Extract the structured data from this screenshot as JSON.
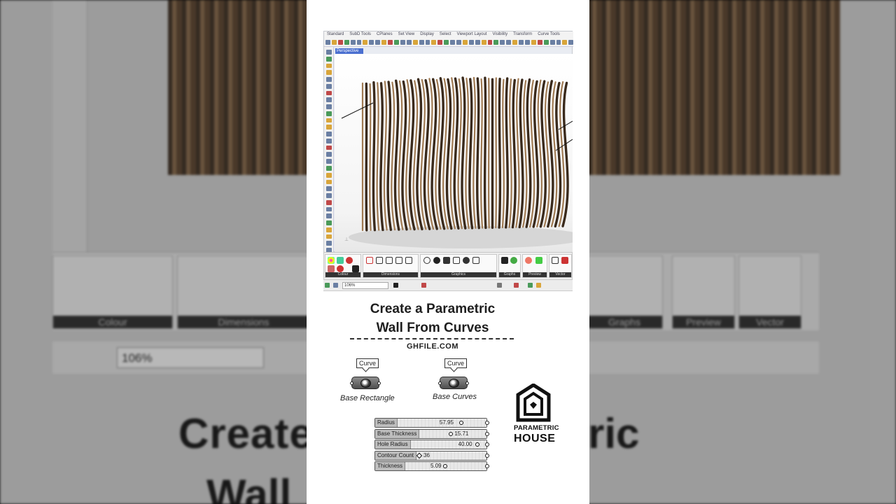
{
  "backdrop": {
    "ribbon_groups": [
      "Colour",
      "Dimensions",
      "Graphs",
      "Preview",
      "Vector"
    ],
    "zoom": "106%",
    "title_fragments": [
      "Create",
      "ric",
      "Wall"
    ]
  },
  "rhino": {
    "menu": [
      "Standard",
      "SubD Tools",
      "CPlanes",
      "Set View",
      "Display",
      "Select",
      "Viewport Layout",
      "Visibility",
      "Transform",
      "Curve Tools"
    ],
    "viewport_tab": "Perspective"
  },
  "grasshopper": {
    "groups": [
      "Colour",
      "Dimensions",
      "Graphics",
      "Graphs",
      "Preview",
      "Vector"
    ],
    "zoom": "106%"
  },
  "title": {
    "line1": "Create a Parametric",
    "line2": "Wall From Curves",
    "website": "GHFILE.COM"
  },
  "components": [
    {
      "tooltip": "Curve",
      "label": "Base Rectangle"
    },
    {
      "tooltip": "Curve",
      "label": "Base Curves"
    }
  ],
  "sliders": [
    {
      "name": "Radius",
      "value": "57.95"
    },
    {
      "name": "Base Thickness",
      "value": "15.71"
    },
    {
      "name": "Hole Radius",
      "value": "40.00"
    },
    {
      "name": "Contour Count",
      "value": "36"
    },
    {
      "name": "Thickness",
      "value": "5.09"
    }
  ],
  "logo": {
    "line1": "PARAMETRIC",
    "line2": "HOUSE"
  },
  "colors": {
    "wood_dark": "#3a2a1c",
    "wood_light": "#a07a52",
    "viewport_tab": "#4a6fd0"
  }
}
